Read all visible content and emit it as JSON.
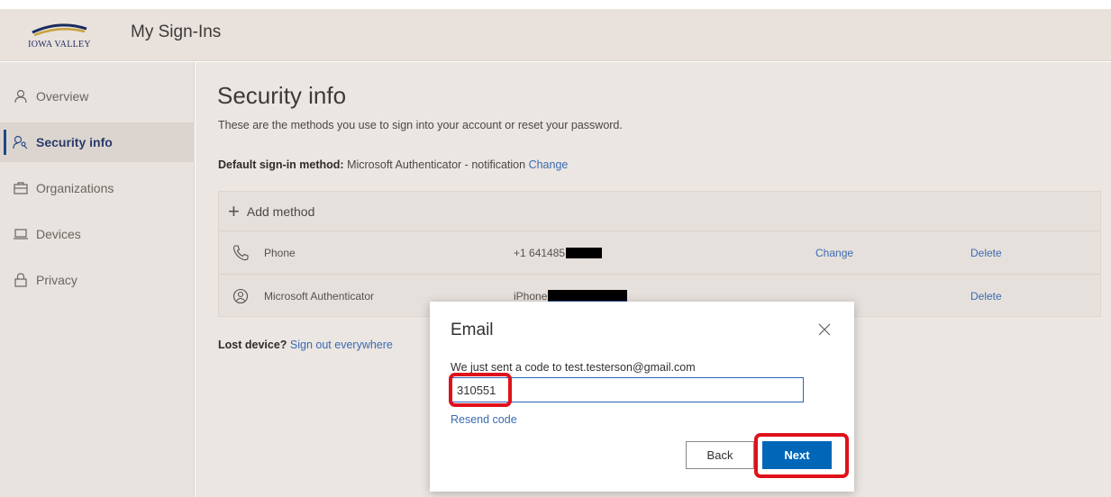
{
  "header": {
    "logo_text": "IOWA VALLEY",
    "app_title": "My Sign-Ins"
  },
  "sidebar": {
    "items": [
      {
        "label": "Overview",
        "icon": "person-icon"
      },
      {
        "label": "Security info",
        "icon": "person-key-icon",
        "active": true
      },
      {
        "label": "Organizations",
        "icon": "briefcase-icon"
      },
      {
        "label": "Devices",
        "icon": "laptop-icon"
      },
      {
        "label": "Privacy",
        "icon": "lock-icon"
      }
    ]
  },
  "main": {
    "title": "Security info",
    "subtitle": "These are the methods you use to sign into your account or reset your password.",
    "default_label": "Default sign-in method:",
    "default_value": "Microsoft Authenticator - notification",
    "default_change": "Change",
    "add_method": "Add method",
    "methods": [
      {
        "name": "Phone",
        "value": "+1 641485",
        "change": "Change",
        "delete": "Delete",
        "icon": "phone-icon"
      },
      {
        "name": "Microsoft Authenticator",
        "value": "iPhone",
        "change": "",
        "delete": "Delete",
        "icon": "authenticator-icon"
      }
    ],
    "lost_device_label": "Lost device?",
    "lost_device_link": "Sign out everywhere"
  },
  "dialog": {
    "title": "Email",
    "message": "We just sent a code to test.testerson@gmail.com",
    "code_value": "310551",
    "resend": "Resend code",
    "back": "Back",
    "next": "Next"
  },
  "colors": {
    "accent": "#0067b8",
    "link": "#3b6bb0",
    "highlight": "#e0111b"
  }
}
